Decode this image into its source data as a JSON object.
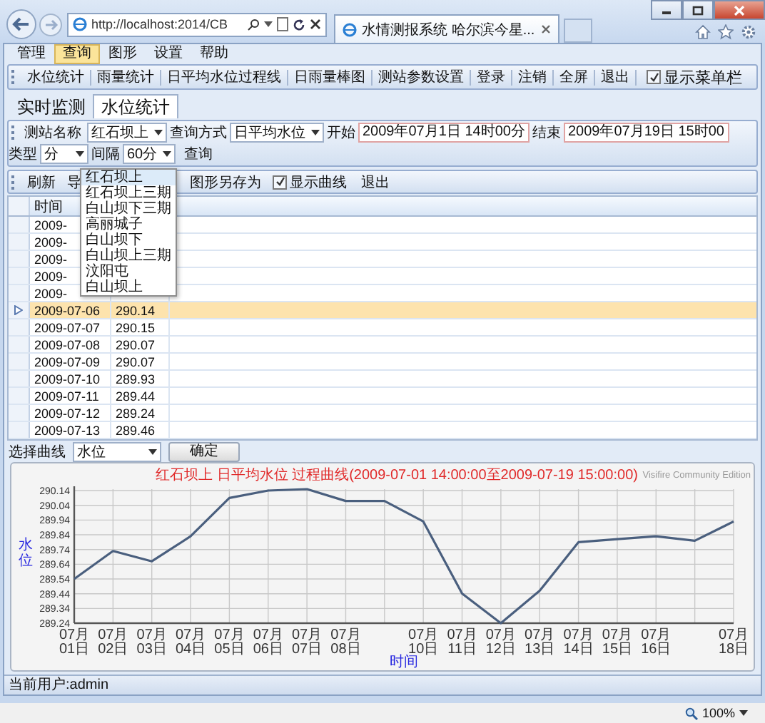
{
  "browser": {
    "address": "http://localhost:2014/CB",
    "tab_title": "水情测报系统 哈尔滨今星..."
  },
  "menu": [
    {
      "label": "管理",
      "selected": false
    },
    {
      "label": "查询",
      "selected": true
    },
    {
      "label": "图形",
      "selected": false
    },
    {
      "label": "设置",
      "selected": false
    },
    {
      "label": "帮助",
      "selected": false
    }
  ],
  "toolbar": {
    "items": [
      "水位统计",
      "雨量统计",
      "日平均水位过程线",
      "日雨量棒图",
      "测站参数设置",
      "登录",
      "注销",
      "全屏",
      "退出"
    ],
    "show_menubar": {
      "label": "显示菜单栏",
      "checked": true
    }
  },
  "tabs": [
    {
      "label": "实时监测",
      "selected": false
    },
    {
      "label": "水位统计",
      "selected": true
    }
  ],
  "query_bar": {
    "fields": [
      {
        "kind": "select",
        "label": "测站名称",
        "value": "红石坝上"
      },
      {
        "kind": "select",
        "label": "查询方式",
        "value": "日平均水位"
      },
      {
        "kind": "text",
        "label": "开始",
        "value": "2009年07月1日 14时00分"
      },
      {
        "kind": "text",
        "label": "结束",
        "value": "2009年07月19日 15时00"
      },
      {
        "kind": "select",
        "label": "类型",
        "value": "分"
      },
      {
        "kind": "select",
        "label": "间隔",
        "value": "60分"
      }
    ],
    "button": "查询"
  },
  "station_dropdown": [
    {
      "label": "红石坝上",
      "selected": true
    },
    {
      "label": "红石坝上三期",
      "selected": false
    },
    {
      "label": "白山坝下三期",
      "selected": false
    },
    {
      "label": "高丽城子",
      "selected": false
    },
    {
      "label": "白山坝下",
      "selected": false
    },
    {
      "label": "白山坝上三期",
      "selected": false
    },
    {
      "label": "汶阳屯",
      "selected": false
    },
    {
      "label": "白山坝上",
      "selected": false
    }
  ],
  "action_bar": [
    {
      "kind": "button",
      "label": "刷新"
    },
    {
      "kind": "button",
      "label": "导"
    },
    {
      "kind": "button",
      "label": "图形另存为"
    },
    {
      "kind": "checkbox",
      "label": "显示曲线",
      "checked": true
    },
    {
      "kind": "button",
      "label": "退出"
    }
  ],
  "grid": {
    "columns": [
      "时间"
    ],
    "rows": [
      {
        "time": "2009-",
        "selected": false
      },
      {
        "time": "2009-",
        "selected": false
      },
      {
        "time": "2009-",
        "selected": false
      },
      {
        "time": "2009-",
        "selected": false
      },
      {
        "time": "2009-",
        "selected": false
      },
      {
        "time": "2009-07-06",
        "value": "290.14",
        "selected": true
      },
      {
        "time": "2009-07-07",
        "value": "290.15",
        "selected": false
      },
      {
        "time": "2009-07-08",
        "value": "290.07",
        "selected": false
      },
      {
        "time": "2009-07-09",
        "value": "290.07",
        "selected": false
      },
      {
        "time": "2009-07-10",
        "value": "289.93",
        "selected": false
      },
      {
        "time": "2009-07-11",
        "value": "289.44",
        "selected": false
      },
      {
        "time": "2009-07-12",
        "value": "289.24",
        "selected": false
      },
      {
        "time": "2009-07-13",
        "value": "289.46",
        "selected": false
      }
    ]
  },
  "curve_select": {
    "label": "选择曲线",
    "value": "水位",
    "button": "确定"
  },
  "chart": {
    "credit": "Visifire Community Edition",
    "chart_data": {
      "type": "line",
      "title": "红石坝上 日平均水位 过程曲线(2009-07-01 14:00:00至2009-07-19 15:00:00)",
      "xlabel": "时间",
      "ylabel": "水位",
      "categories": [
        "07月01日",
        "07月02日",
        "07月03日",
        "07月04日",
        "07月05日",
        "07月06日",
        "07月07日",
        "07月08日",
        null,
        "07月10日",
        "07月11日",
        "07月12日",
        "07月13日",
        "07月14日",
        "07月15日",
        "07月16日",
        null,
        "07月18日"
      ],
      "series": [
        {
          "color": "#4a5f7e",
          "values": [
            289.54,
            289.73,
            289.66,
            289.83,
            290.09,
            290.14,
            290.15,
            290.07,
            290.07,
            289.93,
            289.44,
            289.24,
            289.46,
            289.79,
            289.81,
            289.83,
            289.8,
            289.93
          ]
        }
      ],
      "ylim": [
        289.24,
        290.15
      ],
      "grid": true,
      "yticks": [
        {
          "value": 289.24,
          "label": "289.24"
        },
        {
          "value": 289.34,
          "label": "289.34"
        },
        {
          "value": 289.44,
          "label": "289.44"
        },
        {
          "value": 289.54,
          "label": "289.54"
        },
        {
          "value": 289.64,
          "label": "289.64"
        },
        {
          "value": 289.74,
          "label": "289.74"
        },
        {
          "value": 289.84,
          "label": "289.84"
        },
        {
          "value": 289.94,
          "label": "289.94"
        },
        {
          "value": 290.04,
          "label": "290.04"
        },
        {
          "value": 290.14,
          "label": "290.14"
        }
      ]
    }
  },
  "status_bar": {
    "user": "当前用户:admin"
  },
  "browser_status": {
    "zoom": "100%"
  }
}
